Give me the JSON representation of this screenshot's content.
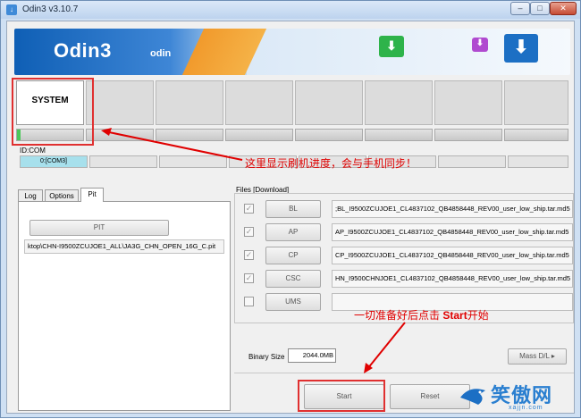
{
  "window": {
    "title": "Odin3 v3.10.7",
    "minimize": "–",
    "maximize": "□",
    "close": "✕"
  },
  "banner": {
    "brand": "Odin3",
    "sub": "odin"
  },
  "slots": [
    "SYSTEM",
    "",
    "",
    "",
    "",
    "",
    "",
    ""
  ],
  "progress": {
    "slot1_fraction": 0.05
  },
  "idcom": {
    "label": "ID:COM",
    "ports": [
      "0:[COM3]",
      "",
      "",
      "",
      "",
      "",
      "",
      ""
    ]
  },
  "tabs": [
    {
      "label": "Log"
    },
    {
      "label": "Options"
    },
    {
      "label": "Pit"
    }
  ],
  "pit": {
    "button": "PIT",
    "path": "ktop\\CHN-I9500ZCUJOE1_ALL\\JA3G_CHN_OPEN_16G_C.pit"
  },
  "files": {
    "label": "Files [Download]",
    "rows": [
      {
        "button": "BL",
        "checked": true,
        "path": ";BL_I9500ZCUJOE1_CL4837102_QB4858448_REV00_user_low_ship.tar.md5"
      },
      {
        "button": "AP",
        "checked": true,
        "path": "AP_I9500ZCUJOE1_CL4837102_QB4858448_REV00_user_low_ship.tar.md5"
      },
      {
        "button": "CP",
        "checked": true,
        "path": "CP_I9500ZCUJOE1_CL4837102_QB4858448_REV00_user_low_ship.tar.md5"
      },
      {
        "button": "CSC",
        "checked": true,
        "path": "HN_I9500CHNJOE1_CL4837102_QB4858448_REV00_user_low_ship.tar.md5"
      },
      {
        "button": "UMS",
        "checked": false,
        "path": ""
      }
    ]
  },
  "binary": {
    "label": "Binary Size",
    "value": "2044.0MB"
  },
  "buttons": {
    "mass_dl": "Mass D/L ▸",
    "start": "Start",
    "reset": "Reset"
  },
  "annotations": {
    "progress_note": "这里显示刷机进度，会与手机同步！",
    "start_note_pre": "一切准备好后点击 ",
    "start_note_bold": "Start",
    "start_note_post": "开始"
  },
  "watermark": {
    "text": "笑傲网",
    "sub": "xajjn.com"
  },
  "colors": {
    "annotation_red": "#e00000",
    "progress_green": "#4cc85a",
    "com_active": "#a7e0ec"
  }
}
